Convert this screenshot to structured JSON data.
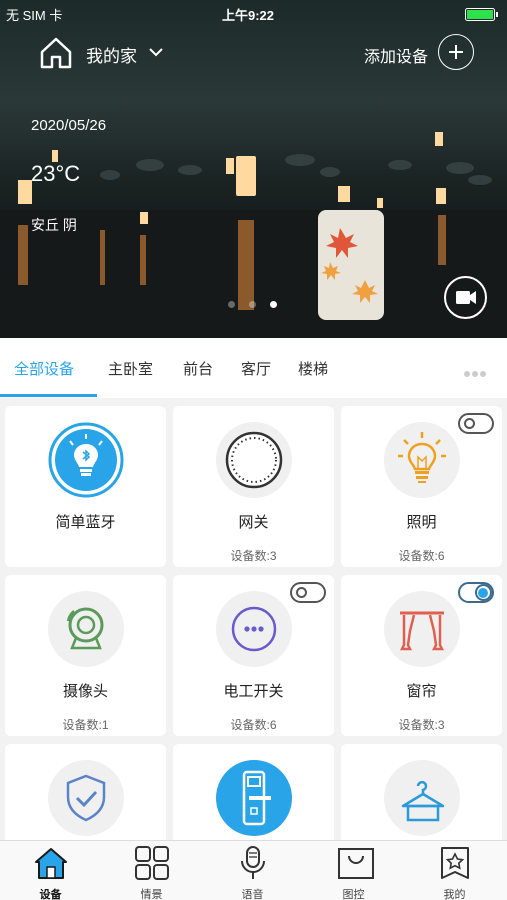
{
  "status_bar": {
    "carrier": "无 SIM 卡",
    "time": "上午9:22"
  },
  "header": {
    "home_name": "我的家",
    "add_device_label": "添加设备"
  },
  "weather": {
    "date": "2020/05/26",
    "temperature": "23°C",
    "location": "安丘 阴"
  },
  "banner": {
    "page_count": 3,
    "active_page": 3
  },
  "tabs": [
    {
      "label": "全部设备",
      "active": true
    },
    {
      "label": "主卧室",
      "active": false
    },
    {
      "label": "前台",
      "active": false
    },
    {
      "label": "客厅",
      "active": false
    },
    {
      "label": "楼梯",
      "active": false
    }
  ],
  "devices": [
    {
      "name": "简单蓝牙",
      "count": "",
      "icon": "bluetooth-bulb-icon",
      "toggle": null
    },
    {
      "name": "网关",
      "count": "设备数:3",
      "icon": "gateway-icon",
      "toggle": null
    },
    {
      "name": "照明",
      "count": "设备数:6",
      "icon": "light-bulb-icon",
      "toggle": "off"
    },
    {
      "name": "摄像头",
      "count": "设备数:1",
      "icon": "camera-icon",
      "toggle": null
    },
    {
      "name": "电工开关",
      "count": "设备数:6",
      "icon": "switch-icon",
      "toggle": "off"
    },
    {
      "name": "窗帘",
      "count": "设备数:3",
      "icon": "curtain-icon",
      "toggle": "on"
    },
    {
      "name": "",
      "count": "",
      "icon": "shield-icon",
      "toggle": null
    },
    {
      "name": "",
      "count": "",
      "icon": "door-lock-icon",
      "toggle": null
    },
    {
      "name": "",
      "count": "",
      "icon": "hanger-icon",
      "toggle": null
    }
  ],
  "bottom_nav": [
    {
      "label": "设备",
      "icon": "home-icon",
      "active": true
    },
    {
      "label": "情景",
      "icon": "grid-icon",
      "active": false
    },
    {
      "label": "语音",
      "icon": "microphone-icon",
      "active": false
    },
    {
      "label": "图控",
      "icon": "bag-icon",
      "active": false
    },
    {
      "label": "我的",
      "icon": "profile-star-icon",
      "active": false
    }
  ],
  "colors": {
    "accent": "#2aa4e8",
    "bulb_orange": "#f0a020",
    "curtain_red": "#e06050",
    "camera_green": "#5a9a5a"
  }
}
